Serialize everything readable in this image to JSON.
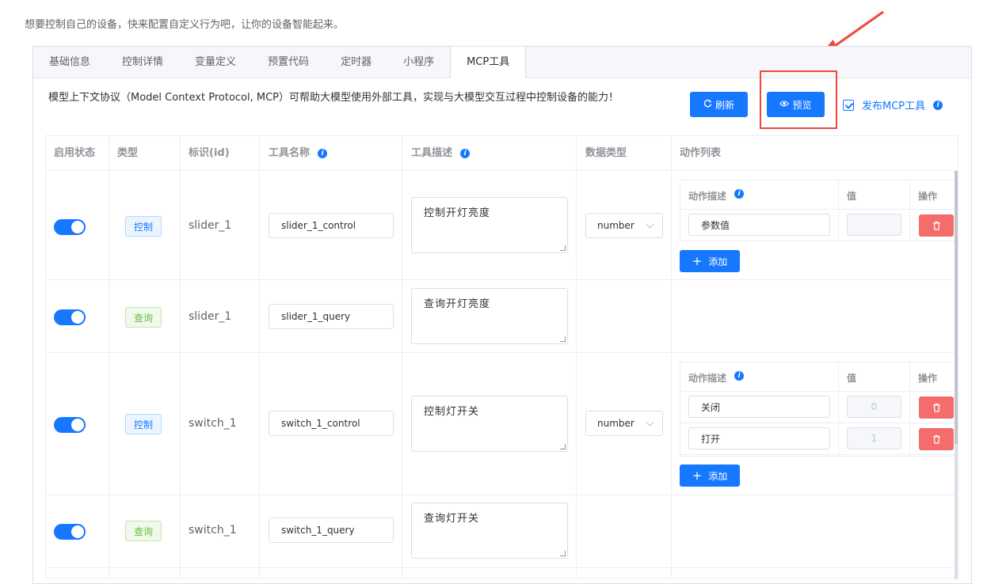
{
  "hint": "想要控制自己的设备，快来配置自定义行为吧，让你的设备智能起来。",
  "tabs": [
    "基础信息",
    "控制详情",
    "变量定义",
    "预置代码",
    "定时器",
    "小程序",
    "MCP工具"
  ],
  "description": "模型上下文协议（Model Context Protocol, MCP）可帮助大模型使用外部工具，实现与大模型交互过程中控制设备的能力！",
  "buttons": {
    "refresh": "刷新",
    "preview": "预览",
    "publish": "发布MCP工具",
    "add": "添加"
  },
  "columns": {
    "enabled": "启用状态",
    "type": "类型",
    "id": "标识(id)",
    "tool_name": "工具名称",
    "tool_desc": "工具描述",
    "data_type": "数据类型",
    "actions": "动作列表"
  },
  "action_columns": {
    "desc": "动作描述",
    "value": "值",
    "op": "操作"
  },
  "rows": [
    {
      "enabled": true,
      "type": "控制",
      "type_kind": "control",
      "id": "slider_1",
      "tool_name": "slider_1_control",
      "tool_desc": "控制开灯亮度",
      "data_type": "number",
      "actions": [
        {
          "desc": "参数值",
          "value": ""
        }
      ]
    },
    {
      "enabled": true,
      "type": "查询",
      "type_kind": "query",
      "id": "slider_1",
      "tool_name": "slider_1_query",
      "tool_desc": "查询开灯亮度"
    },
    {
      "enabled": true,
      "type": "控制",
      "type_kind": "control",
      "id": "switch_1",
      "tool_name": "switch_1_control",
      "tool_desc": "控制灯开关",
      "data_type": "number",
      "actions": [
        {
          "desc": "关闭",
          "value": "0"
        },
        {
          "desc": "打开",
          "value": "1"
        }
      ]
    },
    {
      "enabled": true,
      "type": "查询",
      "type_kind": "query",
      "id": "switch_1",
      "tool_name": "switch_1_query",
      "tool_desc": "查询灯开关"
    }
  ],
  "colors": {
    "primary": "#1677ff",
    "danger": "#f56c6c",
    "highlight": "#f2473c"
  }
}
